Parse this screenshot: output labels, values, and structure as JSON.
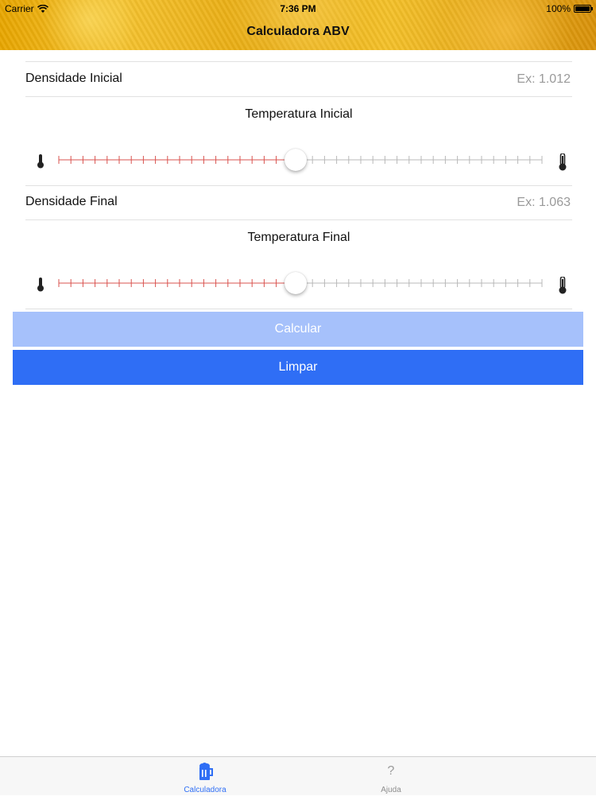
{
  "status_bar": {
    "carrier": "Carrier",
    "time": "7:36 PM",
    "battery": "100%"
  },
  "nav": {
    "title": "Calculadora ABV"
  },
  "form": {
    "initial_density": {
      "label": "Densidade Inicial",
      "value": "",
      "placeholder": "Ex: 1.012"
    },
    "initial_temperature": {
      "label": "Temperatura Inicial",
      "slider_fraction": 0.49
    },
    "final_density": {
      "label": "Densidade Final",
      "value": "",
      "placeholder": "Ex: 1.063"
    },
    "final_temperature": {
      "label": "Temperatura Final",
      "slider_fraction": 0.49
    }
  },
  "buttons": {
    "calculate": "Calcular",
    "clear": "Limpar"
  },
  "tabbar": {
    "items": [
      {
        "label": "Calculadora",
        "icon": "beer-glass-icon",
        "selected": true
      },
      {
        "label": "Ajuda",
        "icon": "question-mark-icon",
        "glyph": "?",
        "selected": false
      }
    ]
  },
  "colors": {
    "accent": "#2f6ef5",
    "calculate_disabled": "#a6c1fb",
    "slider_active": "#d9534f",
    "slider_inactive": "#b8b8b8",
    "navbar": "#e8a600"
  }
}
